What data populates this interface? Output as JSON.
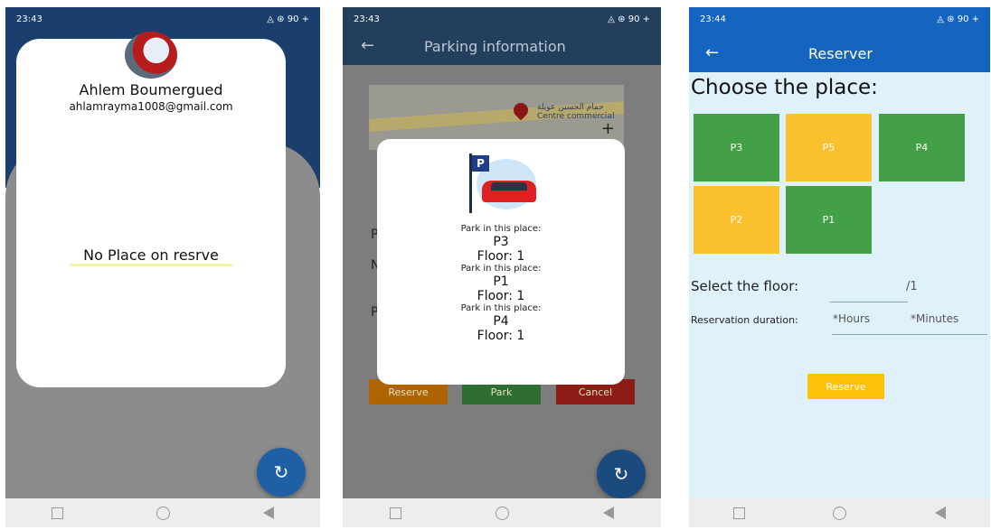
{
  "screen1": {
    "status": {
      "time": "23:43",
      "right": "◬ ⊛ 90 +"
    },
    "user_name": "Ahlem Boumergued",
    "user_email": "ahlamrayma1008@gmail.com",
    "empty_message": "No Place on resrve",
    "refresh_glyph": "↻"
  },
  "screen2": {
    "status": {
      "time": "23:43",
      "right": "◬ ⊛ 90 +"
    },
    "title": "Parking information",
    "map_label_ar": "حمام الحسين عويلة",
    "map_label": "Centre commercial",
    "side_letters": [
      "P",
      "N",
      "P"
    ],
    "buttons": {
      "reserve": "Reserve",
      "park": "Park",
      "cancel": "Cancel"
    },
    "dialog_badge": "P",
    "dialog_items": [
      {
        "prompt": "Park in this place:",
        "place": "P3",
        "floor": "Floor: 1"
      },
      {
        "prompt": "Park in this place:",
        "place": "P1",
        "floor": "Floor: 1"
      },
      {
        "prompt": "Park in this place:",
        "place": "P4",
        "floor": "Floor: 1"
      }
    ],
    "refresh_glyph": "↻"
  },
  "screen3": {
    "status": {
      "time": "23:44",
      "right": "◬ ⊛ 90 +"
    },
    "title": "Reserver",
    "heading": "Choose the place:",
    "slots": [
      {
        "label": "P3",
        "color": "#43a047"
      },
      {
        "label": "P5",
        "color": "#fbc02d"
      },
      {
        "label": "P4",
        "color": "#43a047"
      },
      {
        "label": "P2",
        "color": "#fbc02d"
      },
      {
        "label": "P1",
        "color": "#43a047"
      }
    ],
    "floor_label": "Select the floor:",
    "floor_suffix": "/1",
    "duration_label": "Reservation duration:",
    "hours_placeholder": "*Hours",
    "minutes_placeholder": "*Minutes",
    "reserve_button": "Reserve"
  },
  "nav_icons": [
    "recents-square-icon",
    "home-circle-icon",
    "back-triangle-icon"
  ]
}
